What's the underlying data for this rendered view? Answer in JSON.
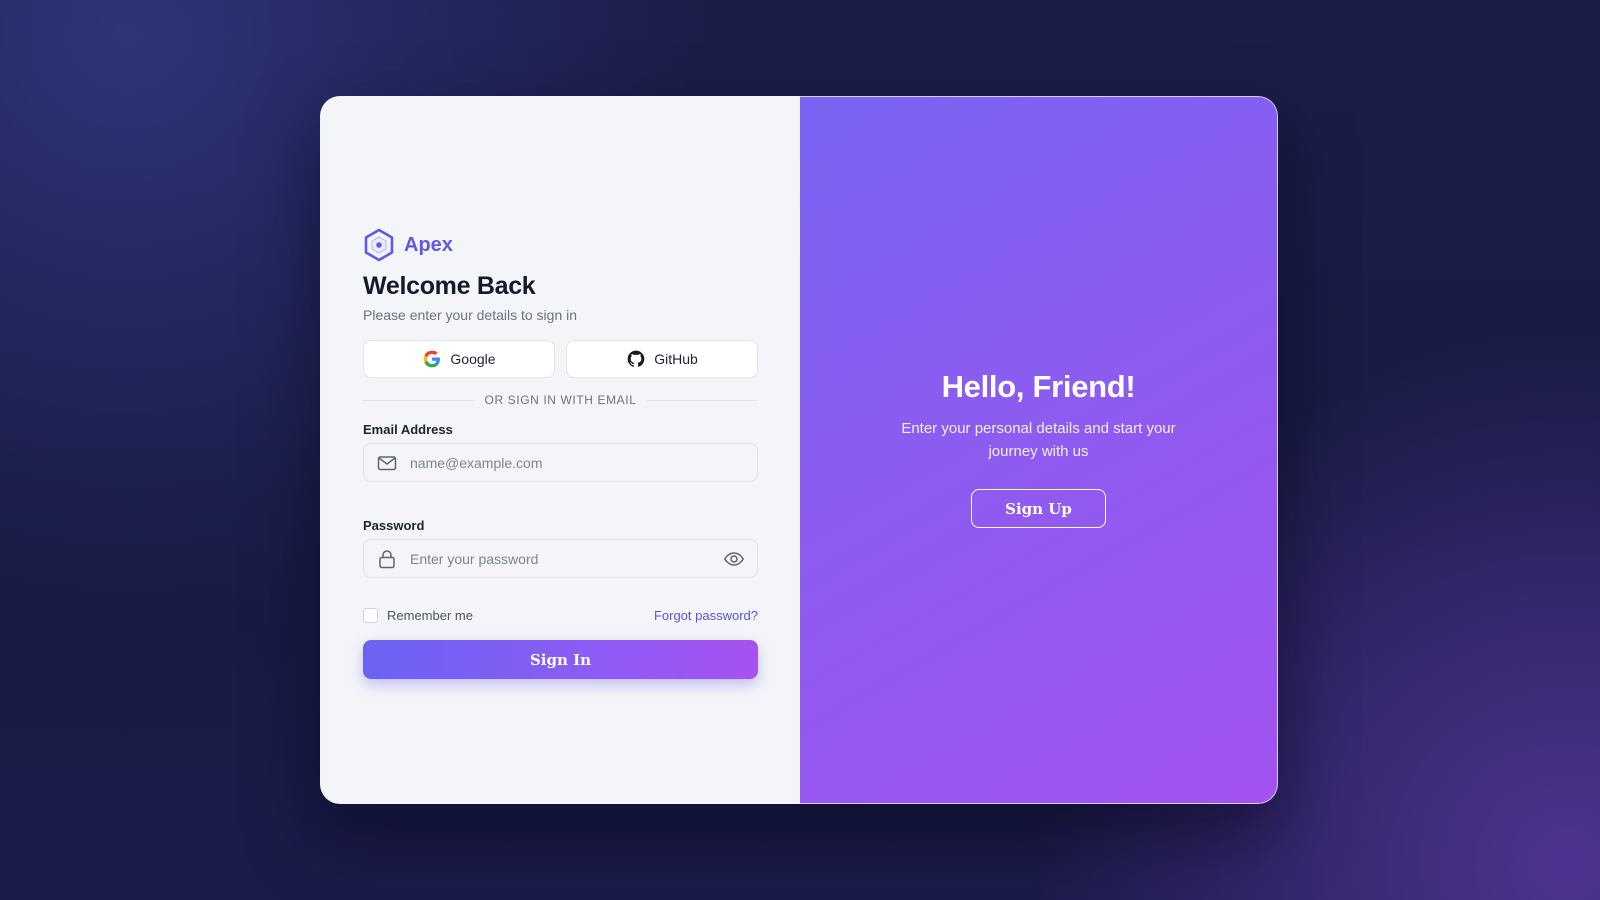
{
  "brand": {
    "name": "Apex"
  },
  "login": {
    "title": "Welcome Back",
    "subtitle": "Please enter your details to sign in",
    "social": {
      "google_label": "Google",
      "github_label": "GitHub"
    },
    "divider_text": "OR SIGN IN WITH EMAIL",
    "email": {
      "label": "Email Address",
      "placeholder": "name@example.com",
      "value": ""
    },
    "password": {
      "label": "Password",
      "placeholder": "Enter your password",
      "value": ""
    },
    "remember_label": "Remember me",
    "remember_checked": false,
    "forgot_label": "Forgot password?",
    "submit_label": "Sign In"
  },
  "panel": {
    "title": "Hello, Friend!",
    "text": "Enter your personal details and start your journey with us",
    "button_label": "Sign Up"
  },
  "icons": {
    "brand": "hexagon-logo-icon",
    "google": "google-icon",
    "github": "github-icon",
    "email": "mail-icon",
    "password": "lock-icon",
    "toggle": "eye-icon"
  },
  "colors": {
    "accent": "#6157e8",
    "panel_start": "#7a63f2",
    "panel_end": "#a352f0",
    "background": "#1b1d49"
  }
}
